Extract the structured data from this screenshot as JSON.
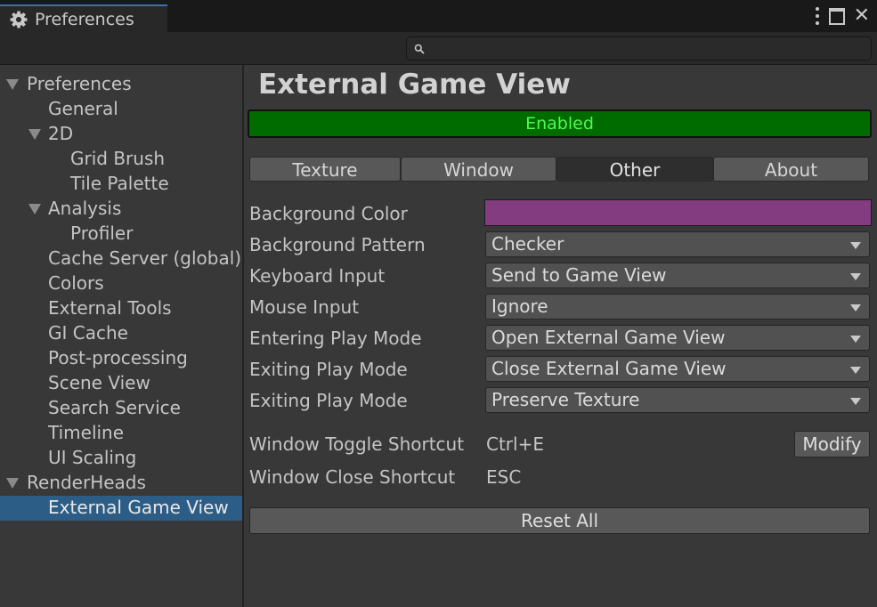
{
  "window": {
    "tab_title": "Preferences",
    "controls": {
      "more": "more-options-icon",
      "maximize": "maximize-icon",
      "close": "close-icon"
    }
  },
  "search": {
    "value": "",
    "placeholder": ""
  },
  "sidebar": {
    "items": [
      {
        "label": "Preferences",
        "expanded": true
      },
      {
        "label": "General"
      },
      {
        "label": "2D",
        "expanded": true
      },
      {
        "label": "Grid Brush"
      },
      {
        "label": "Tile Palette"
      },
      {
        "label": "Analysis",
        "expanded": true
      },
      {
        "label": "Profiler"
      },
      {
        "label": "Cache Server (global)"
      },
      {
        "label": "Colors"
      },
      {
        "label": "External Tools"
      },
      {
        "label": "GI Cache"
      },
      {
        "label": "Post-processing"
      },
      {
        "label": "Scene View"
      },
      {
        "label": "Search Service"
      },
      {
        "label": "Timeline"
      },
      {
        "label": "UI Scaling"
      },
      {
        "label": "RenderHeads",
        "expanded": true
      },
      {
        "label": "External Game View",
        "selected": true
      }
    ]
  },
  "main": {
    "title": "External Game View",
    "status": "Enabled",
    "tabs": [
      {
        "label": "Texture"
      },
      {
        "label": "Window"
      },
      {
        "label": "Other",
        "active": true
      },
      {
        "label": "About"
      }
    ],
    "fields": {
      "background_color": {
        "label": "Background Color",
        "color": "#833c80"
      },
      "background_pattern": {
        "label": "Background Pattern",
        "value": "Checker"
      },
      "keyboard_input": {
        "label": "Keyboard Input",
        "value": "Send to Game View"
      },
      "mouse_input": {
        "label": "Mouse Input",
        "value": "Ignore"
      },
      "entering_play_mode": {
        "label": "Entering Play Mode",
        "value": "Open External Game View"
      },
      "exiting_play_mode": {
        "label": "Exiting Play Mode",
        "value": "Close External Game View"
      },
      "exiting_play_mode_texture": {
        "label": "Exiting Play Mode",
        "value": "Preserve Texture"
      },
      "window_toggle_shortcut": {
        "label": "Window Toggle Shortcut",
        "value": "Ctrl+E",
        "button": "Modify"
      },
      "window_close_shortcut": {
        "label": "Window Close Shortcut",
        "value": "ESC"
      }
    },
    "reset_label": "Reset All"
  },
  "colors": {
    "accent": "#2c5d87",
    "enabled_bg": "#006c00",
    "enabled_text": "#4dfb4d",
    "panel_bg": "#383838"
  }
}
